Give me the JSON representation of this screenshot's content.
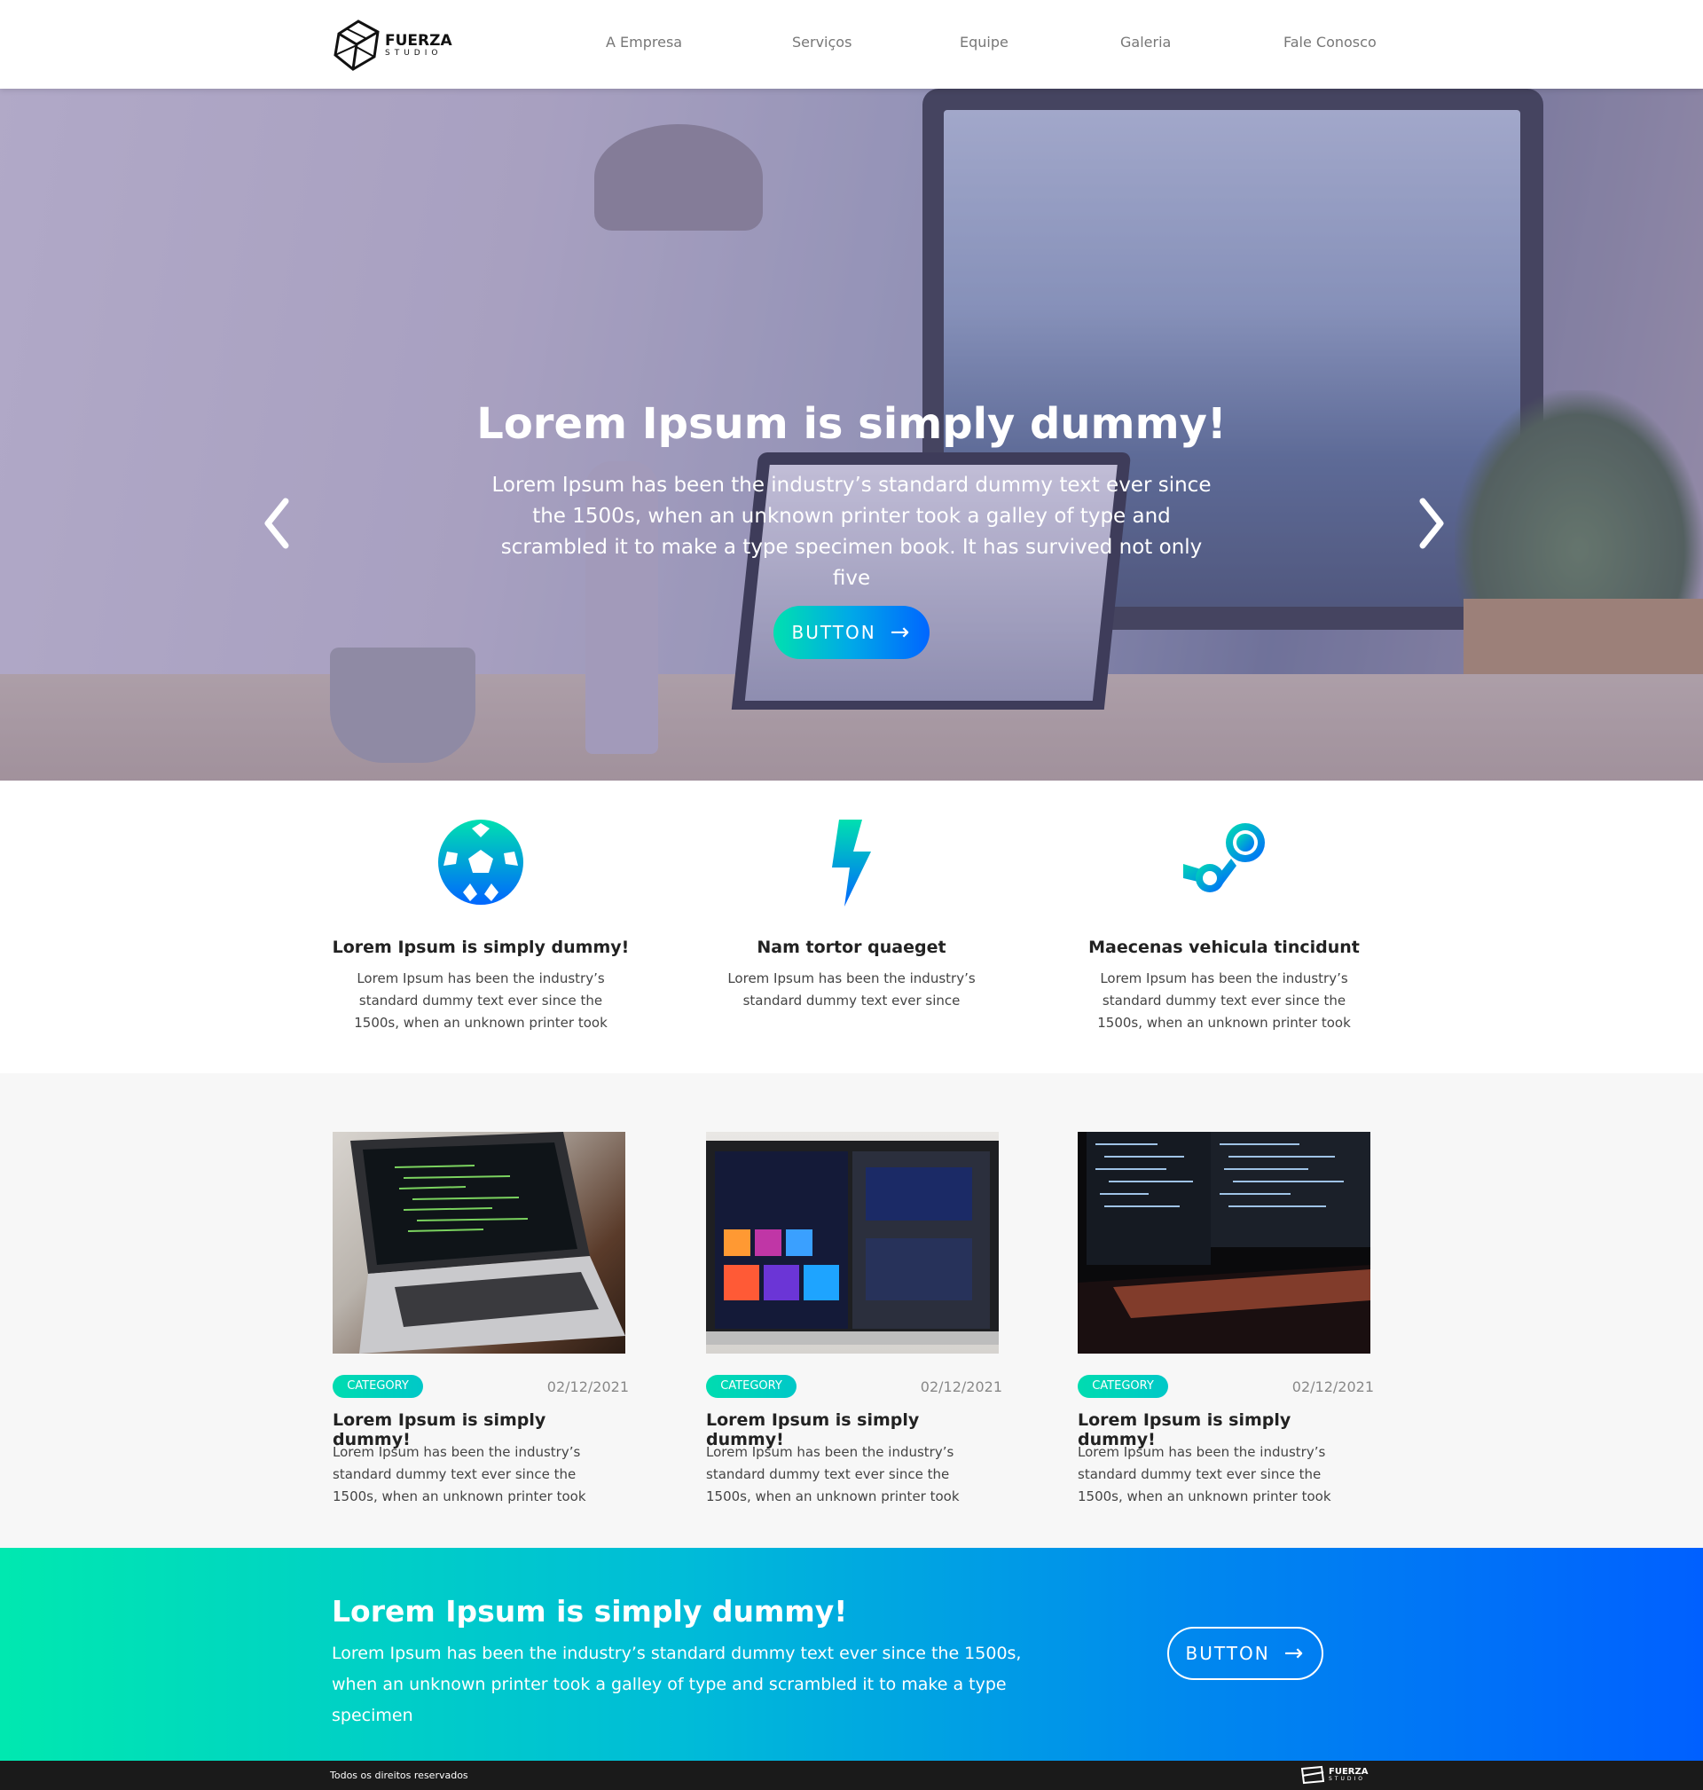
{
  "brand": {
    "logo_main": "FUERZA",
    "logo_sub": "STUDIO"
  },
  "nav": {
    "items": [
      {
        "label": "A Empresa"
      },
      {
        "label": "Serviços"
      },
      {
        "label": "Equipe"
      },
      {
        "label": "Galeria"
      },
      {
        "label": "Fale Conosco"
      }
    ]
  },
  "hero": {
    "title": "Lorem Ipsum is simply dummy!",
    "text": "Lorem Ipsum has been the industry’s standard dummy text ever since the 1500s, when an unknown printer took a galley of type and scrambled it to make a type specimen book. It has survived not only five",
    "button_label": "BUTTON",
    "prev_icon": "chevron-left-icon",
    "next_icon": "chevron-right-icon"
  },
  "features": [
    {
      "icon": "soccer-ball-icon",
      "title": "Lorem Ipsum is simply dummy!",
      "text": "Lorem Ipsum has been the industry’s standard dummy text ever since the 1500s, when an unknown printer took"
    },
    {
      "icon": "lightning-bolt-icon",
      "title": "Nam tortor quaeget",
      "text": "Lorem Ipsum has been the industry’s standard dummy text ever since"
    },
    {
      "icon": "steam-icon",
      "title": "Maecenas vehicula tincidunt",
      "text": "Lorem Ipsum has been the industry’s standard dummy text ever since the 1500s, when an unknown printer took"
    }
  ],
  "posts": [
    {
      "category": "CATEGORY",
      "date": "02/12/2021",
      "title": "Lorem Ipsum is simply dummy!",
      "text": "Lorem Ipsum has been the industry’s standard dummy text ever since the 1500s, when an unknown printer took"
    },
    {
      "category": "CATEGORY",
      "date": "02/12/2021",
      "title": "Lorem Ipsum is simply dummy!",
      "text": "Lorem Ipsum has been the industry’s standard dummy text ever since the 1500s, when an unknown printer took"
    },
    {
      "category": "CATEGORY",
      "date": "02/12/2021",
      "title": "Lorem Ipsum is simply dummy!",
      "text": "Lorem Ipsum has been the industry’s standard dummy text ever since the 1500s, when an unknown printer took"
    }
  ],
  "cta": {
    "title": "Lorem Ipsum is simply dummy!",
    "text": "Lorem Ipsum has been the industry’s standard dummy text ever since the 1500s, when an unknown printer took a galley of type and scrambled it to make a type specimen",
    "button_label": "BUTTON"
  },
  "footer": {
    "copyright": "Todos os direitos reservados",
    "logo_main": "FUERZA",
    "logo_sub": "STUDIO"
  },
  "colors": {
    "accent_start": "#00e0b0",
    "accent_end": "#0060ff"
  }
}
